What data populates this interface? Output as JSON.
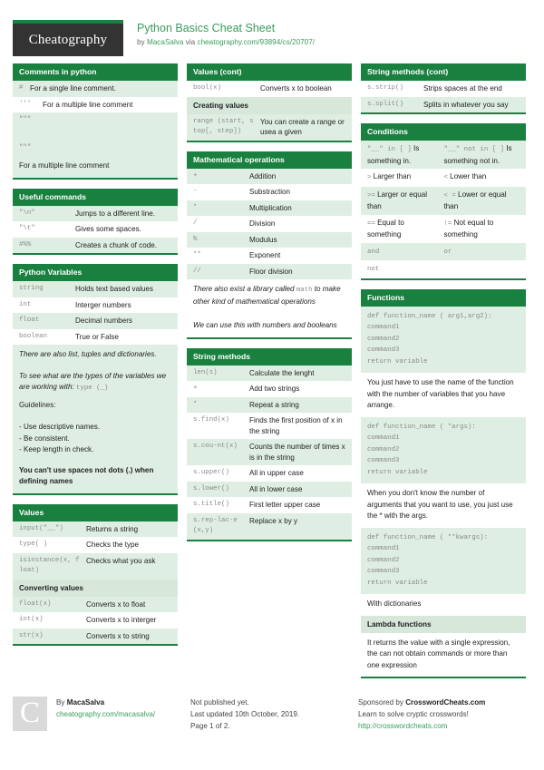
{
  "header": {
    "logo_text": "Cheatography",
    "title": "Python Basics Cheat Sheet",
    "byline_prefix": "by ",
    "author": "MacaSalva",
    "byline_middle": " via ",
    "source_url": "cheatography.com/93894/cs/20707/"
  },
  "blocks": {
    "comments": {
      "title": "Comments in python",
      "rows": [
        {
          "code": "#",
          "desc": "For a single line comment."
        },
        {
          "code": "'''",
          "desc": "For a multiple line comment"
        },
        {
          "code": "\"\"\"",
          "desc": ""
        },
        {
          "code": "\"\"\"",
          "desc": ""
        }
      ],
      "footer_note": "For a multiple line comment"
    },
    "useful_commands": {
      "title": "Useful commands",
      "rows": [
        {
          "code": "\"\\n\"",
          "desc": "Jumps to a different line."
        },
        {
          "code": "\"\\t\"",
          "desc": "Gives some spaces."
        },
        {
          "code": "#%%",
          "desc": "Creates a chunk of code."
        }
      ]
    },
    "python_variables": {
      "title": "Python Variables",
      "rows": [
        {
          "code": "string",
          "desc": "Holds text based values"
        },
        {
          "code": "int",
          "desc": "Interger numbers"
        },
        {
          "code": "float",
          "desc": "Decimal numbers"
        },
        {
          "code": "boolean",
          "desc": "True or False"
        }
      ],
      "note1": "There are also list, tuples and dictionaries.",
      "note2_a": "To see what are the types of the variables we are working with: ",
      "note2_code": "type (_)",
      "note3": "Guidelines:",
      "guideline1": "- Use descriptive names.",
      "guideline2": "- Be consistent.",
      "guideline3": "- Keep length in check.",
      "note4": "You can't use spaces not dots (.) when defining names"
    },
    "values": {
      "title": "Values",
      "rows": [
        {
          "code": "input(\"__\")",
          "desc": "Returns a string"
        },
        {
          "code": "type( )",
          "desc": "Checks the type"
        },
        {
          "code": "isinstance(x, float)",
          "desc": "Checks what you ask"
        }
      ],
      "sub_title": "Converting values",
      "sub_rows": [
        {
          "code": "float(x)",
          "desc": "Converts x to float"
        },
        {
          "code": "int(x)",
          "desc": "Converts x to interger"
        },
        {
          "code": "str(x)",
          "desc": "Converts x to string"
        }
      ]
    },
    "values_cont": {
      "title": "Values (cont)",
      "rows": [
        {
          "code": "bool(x)",
          "desc": "Converts x to boolean"
        }
      ],
      "sub_title": "Creating values",
      "sub_rows": [
        {
          "code": "range (start, stop[, step])",
          "desc": "You can create a range or usea a given"
        }
      ]
    },
    "math_operations": {
      "title": "Mathematical operations",
      "rows": [
        {
          "code": "+",
          "desc": "Addition"
        },
        {
          "code": "-",
          "desc": "Substraction"
        },
        {
          "code": "*",
          "desc": "Multiplication"
        },
        {
          "code": "/",
          "desc": "Division"
        },
        {
          "code": "%",
          "desc": "Modulus"
        },
        {
          "code": "**",
          "desc": "Exponent"
        },
        {
          "code": "//",
          "desc": "Floor division"
        }
      ],
      "note1_a": "There also exist a library called ",
      "note1_code": "math",
      "note1_b": " to make other kind of mathematical operations",
      "note2": "We can use this with numbers and booleans"
    },
    "string_methods": {
      "title": "String methods",
      "rows": [
        {
          "code": "len(s)",
          "desc": "Calculate the lenght"
        },
        {
          "code": "+",
          "desc": "Add two strings"
        },
        {
          "code": "*",
          "desc": "Repeat a string"
        },
        {
          "code": "s.find(x)",
          "desc": "Finds the first position of x in the string"
        },
        {
          "code": "s.cou-nt(x)",
          "desc": "Counts the number of times x is in the string"
        },
        {
          "code": "s.upper()",
          "desc": "All in upper case"
        },
        {
          "code": "s.lower()",
          "desc": "All in lower case"
        },
        {
          "code": "s.title()",
          "desc": "First letter upper case"
        },
        {
          "code": "s.rep-lac-e(x,y)",
          "desc": "Replace x by y"
        }
      ]
    },
    "string_methods_cont": {
      "title": "String methods (cont)",
      "rows": [
        {
          "code": "s.strip()",
          "desc": "Strips spaces at the end"
        },
        {
          "code": "s.split()",
          "desc": "Splits in whatever you say"
        }
      ]
    },
    "conditions": {
      "title": "Conditions",
      "rows": [
        {
          "left_code": "\"__\" in [ ]",
          "left_desc": " Is something in.",
          "right_code": "\"__\" not in [ ]",
          "right_desc": " Is something not in."
        },
        {
          "left_code": ">",
          "left_desc": " Larger than",
          "right_code": "<",
          "right_desc": " Lower than"
        },
        {
          "left_code": ">=",
          "left_desc": " Larger or equal than",
          "right_code": "< =",
          "right_desc": " Lower or equal than"
        },
        {
          "left_code": "==",
          "left_desc": " Equal to something",
          "right_code": "!=",
          "right_desc": " Not equal to something"
        },
        {
          "left_code": "and",
          "left_desc": "",
          "right_code": "or",
          "right_desc": ""
        },
        {
          "left_code": "not",
          "left_desc": "",
          "right_code": "",
          "right_desc": ""
        }
      ]
    },
    "functions": {
      "title": "Functions",
      "code1": [
        "def function_name ( arg1,arg2):",
        "command1",
        "command2",
        "command3",
        "return variable"
      ],
      "note1": "You just have to use the name of the function with the number of variables that you have arrange.",
      "code2": [
        "def function_name ( *args):",
        "command1",
        "command2",
        "command3",
        "return variable"
      ],
      "note2": "When you don't know the number of arguments that you want to use, you just use the * with the args.",
      "code3": [
        "def function_name ( **kwargs):",
        "command1",
        "command2",
        "command3",
        "return variable"
      ],
      "note3": "With dictionaries",
      "sub_title": "Lambda functions",
      "note4": "It returns the value with a single expression, the can not obtain commands or more than one expression"
    }
  },
  "footer": {
    "logo_letter": "C",
    "by_prefix": "By ",
    "author": "MacaSalva",
    "author_url": "cheatography.com/macasalva/",
    "published_status": "Not published yet.",
    "last_updated": "Last updated 10th October, 2019.",
    "page_number": "Page 1 of 2.",
    "sponsor_prefix": "Sponsored by ",
    "sponsor_name": "CrosswordCheats.com",
    "sponsor_tagline": "Learn to solve cryptic crosswords!",
    "sponsor_url": "http://crosswordcheats.com"
  }
}
